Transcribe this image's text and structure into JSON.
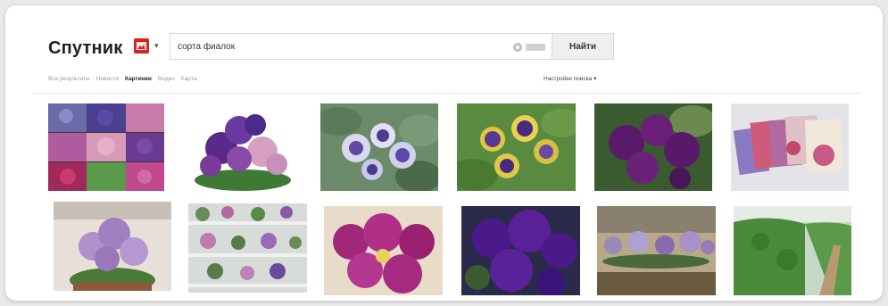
{
  "header": {
    "logo_text": "Спутник",
    "logo_icon": "sputnik-logo-icon",
    "logo_color": "#d6261f"
  },
  "search": {
    "query": "сорта фиалок",
    "button_label": "Найти",
    "clear_icon": "clear-icon",
    "keyboard_icon": "keyboard-icon"
  },
  "tabs": [
    {
      "label": "Все результаты",
      "active": false
    },
    {
      "label": "Новости",
      "active": false
    },
    {
      "label": "Картинки",
      "active": true
    },
    {
      "label": "Видео",
      "active": false
    },
    {
      "label": "Карты",
      "active": false
    }
  ],
  "settings_label": "Настройки поиска ▾",
  "results": [
    {
      "subject": "violet collage"
    },
    {
      "subject": "purple and pink violets"
    },
    {
      "subject": "purple-white violets"
    },
    {
      "subject": "purple and yellow striped violets"
    },
    {
      "subject": "dark purple violets"
    },
    {
      "subject": "magazines about violets"
    },
    {
      "subject": "lilac violet in pot"
    },
    {
      "subject": "violet collection on shelves"
    },
    {
      "subject": "magenta violets"
    },
    {
      "subject": "deep purple violets"
    },
    {
      "subject": "violets on windowsill"
    },
    {
      "subject": "green hedge garden"
    }
  ],
  "colors": {
    "accent": "#d6261f",
    "active_tab": "#222222",
    "inactive_tab": "#9a9a9a"
  }
}
